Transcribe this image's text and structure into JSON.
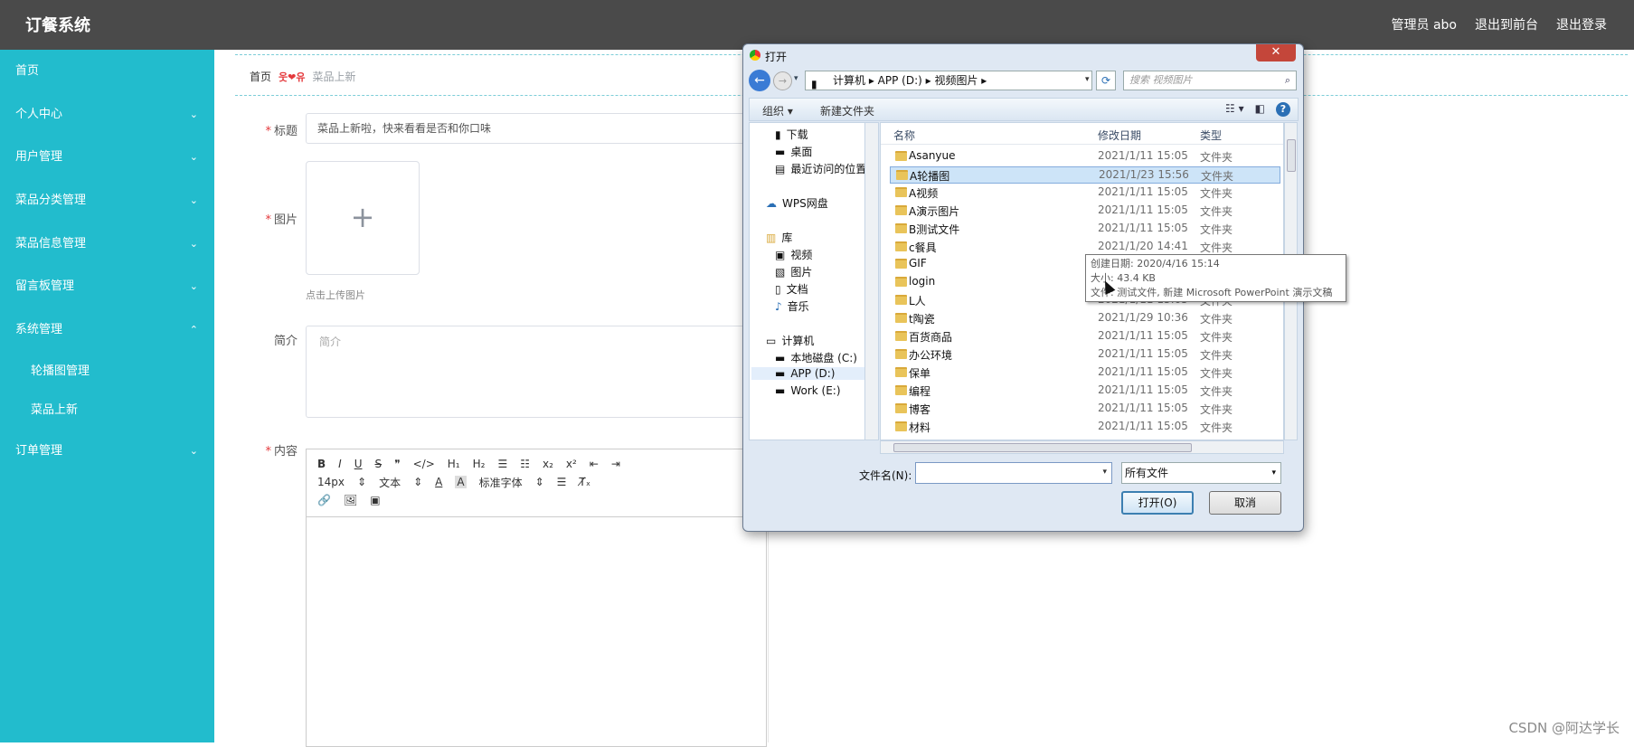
{
  "app": {
    "brand": "订餐系统",
    "top_links": [
      "管理员 abo",
      "退出到前台",
      "退出登录"
    ]
  },
  "sidebar": {
    "items": [
      {
        "label": "首页",
        "chevron": ""
      },
      {
        "label": "个人中心",
        "chevron": "⌄"
      },
      {
        "label": "用户管理",
        "chevron": "⌄"
      },
      {
        "label": "菜品分类管理",
        "chevron": "⌄"
      },
      {
        "label": "菜品信息管理",
        "chevron": "⌄"
      },
      {
        "label": "留言板管理",
        "chevron": "⌄"
      },
      {
        "label": "系统管理",
        "chevron": "⌃"
      }
    ],
    "sub_items": [
      "轮播图管理",
      "菜品上新"
    ],
    "order_item": {
      "label": "订单管理",
      "chevron": "⌄"
    }
  },
  "breadcrumb": {
    "home": "首页",
    "separator": "웃❤유",
    "current": "菜品上新"
  },
  "form": {
    "title_label": "标题",
    "title_value": "菜品上新啦，快来看看是否和你口味",
    "image_label": "图片",
    "upload_plus": "+",
    "upload_tip": "点击上传图片",
    "intro_label": "简介",
    "intro_placeholder": "简介",
    "content_label": "内容"
  },
  "editor": {
    "row1": [
      "B",
      "I",
      "U",
      "S",
      "❞",
      "</>",
      "H₁",
      "H₂",
      "☰",
      "☷",
      "x₂",
      "x²",
      "⇤",
      "⇥"
    ],
    "font_size": "14px",
    "text_style": "文本",
    "font_family": "标准字体",
    "row3": [
      "🔗",
      "🖼",
      "▣"
    ]
  },
  "dialog": {
    "title": "打开",
    "close": "✕",
    "address_path": "计算机 ▸ APP (D:) ▸ 视频图片 ▸",
    "search_placeholder": "搜索 视频图片",
    "organize": "组织 ▾",
    "new_folder": "新建文件夹",
    "nav_items": [
      {
        "label": "下载",
        "icon": "download-folder-icon"
      },
      {
        "label": "桌面",
        "icon": "desktop-icon"
      },
      {
        "label": "最近访问的位置",
        "icon": "recent-places-icon"
      },
      {
        "label": "WPS网盘",
        "icon": "cloud-icon"
      },
      {
        "label": "库",
        "icon": "library-icon"
      },
      {
        "label": "视频",
        "icon": "video-icon"
      },
      {
        "label": "图片",
        "icon": "picture-icon"
      },
      {
        "label": "文档",
        "icon": "document-icon"
      },
      {
        "label": "音乐",
        "icon": "music-icon"
      },
      {
        "label": "计算机",
        "icon": "computer-icon"
      },
      {
        "label": "本地磁盘 (C:)",
        "icon": "drive-icon"
      },
      {
        "label": "APP (D:)",
        "icon": "drive-icon"
      },
      {
        "label": "Work (E:)",
        "icon": "drive-icon"
      }
    ],
    "columns": {
      "name": "名称",
      "date": "修改日期",
      "type": "类型"
    },
    "files": [
      {
        "name": "Asanyue",
        "date": "2021/1/11 15:05",
        "type": "文件夹"
      },
      {
        "name": "A轮播图",
        "date": "2021/1/23 15:56",
        "type": "文件夹"
      },
      {
        "name": "A视频",
        "date": "2021/1/11 15:05",
        "type": "文件夹"
      },
      {
        "name": "A演示图片",
        "date": "2021/1/11 15:05",
        "type": "文件夹"
      },
      {
        "name": "B测试文件",
        "date": "2021/1/11 15:05",
        "type": "文件夹"
      },
      {
        "name": "c餐具",
        "date": "2021/1/20 14:41",
        "type": "文件夹"
      },
      {
        "name": "GIF",
        "date": "",
        "type": ""
      },
      {
        "name": "login",
        "date": "",
        "type": ""
      },
      {
        "name": "L人",
        "date": "2021/1/11 15:05",
        "type": "文件夹"
      },
      {
        "name": "t陶瓷",
        "date": "2021/1/29 10:36",
        "type": "文件夹"
      },
      {
        "name": "百货商品",
        "date": "2021/1/11 15:05",
        "type": "文件夹"
      },
      {
        "name": "办公环境",
        "date": "2021/1/11 15:05",
        "type": "文件夹"
      },
      {
        "name": "保单",
        "date": "2021/1/11 15:05",
        "type": "文件夹"
      },
      {
        "name": "编程",
        "date": "2021/1/11 15:05",
        "type": "文件夹"
      },
      {
        "name": "博客",
        "date": "2021/1/11 15:05",
        "type": "文件夹"
      },
      {
        "name": "材料",
        "date": "2021/1/11 15:05",
        "type": "文件夹"
      }
    ],
    "selected_file": "A轮播图",
    "filename_label": "文件名(N):",
    "filename_value": "",
    "filetype": "所有文件",
    "open_button": "打开(O)",
    "cancel_button": "取消",
    "tooltip": [
      "创建日期: 2020/4/16 15:14",
      "大小: 43.4 KB",
      "文件: 测试文件, 新建 Microsoft PowerPoint 演示文稿"
    ]
  },
  "watermark": "CSDN @阿达学长",
  "colors": {
    "topbar": "#4a4a4a",
    "sidebar": "#22bccd",
    "required_star": "#e4393c"
  }
}
